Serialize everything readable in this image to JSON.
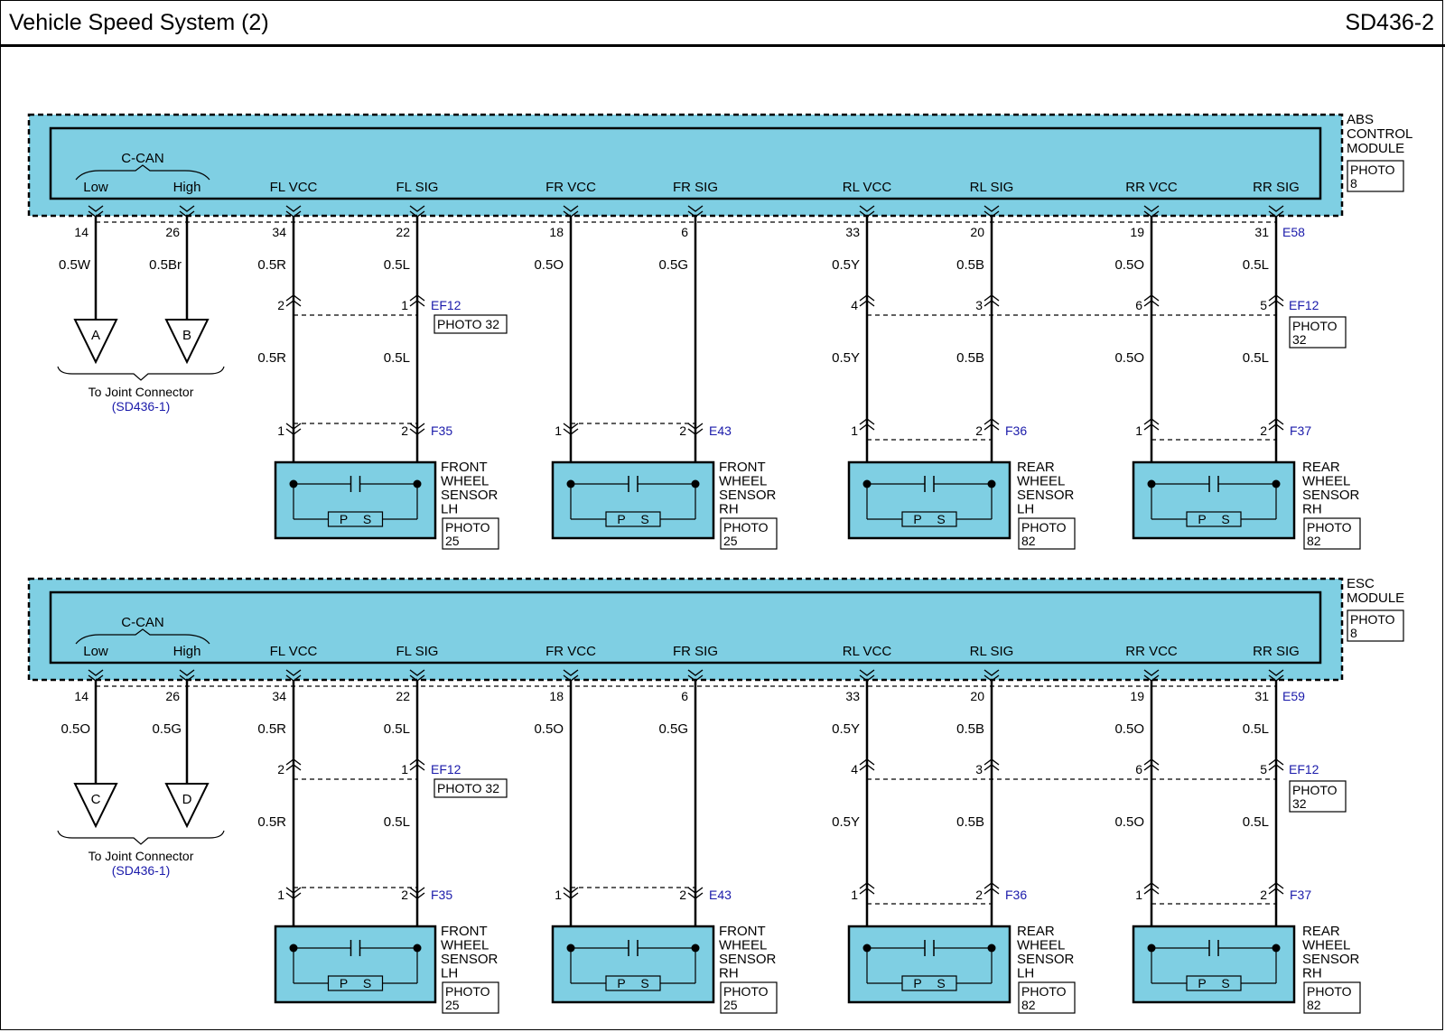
{
  "header": {
    "title": "Vehicle Speed System (2)",
    "code": "SD436-2"
  },
  "colors": {
    "module_fill": "#7fcfe3",
    "link_blue": "#1a1aaa",
    "wire": "#000000"
  },
  "modules": [
    {
      "id": "abs",
      "name_lines": [
        "ABS",
        "CONTROL",
        "MODULE"
      ],
      "photo_lines": [
        "PHOTO",
        "8"
      ],
      "bus_label": "C-CAN",
      "can_pins": [
        {
          "label": "Low",
          "pin": "14",
          "wire": "0.5W",
          "terminal": "A"
        },
        {
          "label": "High",
          "pin": "26",
          "wire": "0.5Br",
          "terminal": "B"
        }
      ],
      "joint_connector": "To Joint Connector",
      "joint_ref": "(SD436-1)",
      "main_connector": "E58",
      "channels": [
        {
          "label": "FL VCC",
          "pin": "34",
          "wire_top": "0.5R",
          "ef_pin": "2",
          "wire_bottom": "0.5R",
          "f_pin": "1"
        },
        {
          "label": "FL SIG",
          "pin": "22",
          "wire_top": "0.5L",
          "ef_pin": "1",
          "wire_bottom": "0.5L",
          "f_pin": "2"
        },
        {
          "label": "FR VCC",
          "pin": "18",
          "wire_top": "0.5O",
          "f_pin": "1"
        },
        {
          "label": "FR SIG",
          "pin": "6",
          "wire_top": "0.5G",
          "f_pin": "2"
        },
        {
          "label": "RL VCC",
          "pin": "33",
          "wire_top": "0.5Y",
          "ef_pin": "4",
          "wire_bottom": "0.5Y",
          "f_pin": "1"
        },
        {
          "label": "RL SIG",
          "pin": "20",
          "wire_top": "0.5B",
          "ef_pin": "3",
          "wire_bottom": "0.5B",
          "f_pin": "2"
        },
        {
          "label": "RR VCC",
          "pin": "19",
          "wire_top": "0.5O",
          "ef_pin": "6",
          "wire_bottom": "0.5O",
          "f_pin": "1"
        },
        {
          "label": "RR SIG",
          "pin": "31",
          "wire_top": "0.5L",
          "ef_pin": "5",
          "wire_bottom": "0.5L",
          "f_pin": "2"
        }
      ]
    },
    {
      "id": "esc",
      "name_lines": [
        "ESC",
        "MODULE"
      ],
      "photo_lines": [
        "PHOTO",
        "8"
      ],
      "bus_label": "C-CAN",
      "can_pins": [
        {
          "label": "Low",
          "pin": "14",
          "wire": "0.5O",
          "terminal": "C"
        },
        {
          "label": "High",
          "pin": "26",
          "wire": "0.5G",
          "terminal": "D"
        }
      ],
      "joint_connector": "To Joint Connector",
      "joint_ref": "(SD436-1)",
      "main_connector": "E59",
      "channels": [
        {
          "label": "FL VCC",
          "pin": "34",
          "wire_top": "0.5R",
          "ef_pin": "2",
          "wire_bottom": "0.5R",
          "f_pin": "1"
        },
        {
          "label": "FL SIG",
          "pin": "22",
          "wire_top": "0.5L",
          "ef_pin": "1",
          "wire_bottom": "0.5L",
          "f_pin": "2"
        },
        {
          "label": "FR VCC",
          "pin": "18",
          "wire_top": "0.5O",
          "f_pin": "1"
        },
        {
          "label": "FR SIG",
          "pin": "6",
          "wire_top": "0.5G",
          "f_pin": "2"
        },
        {
          "label": "RL VCC",
          "pin": "33",
          "wire_top": "0.5Y",
          "ef_pin": "4",
          "wire_bottom": "0.5Y",
          "f_pin": "1"
        },
        {
          "label": "RL SIG",
          "pin": "20",
          "wire_top": "0.5B",
          "ef_pin": "3",
          "wire_bottom": "0.5B",
          "f_pin": "2"
        },
        {
          "label": "RR VCC",
          "pin": "19",
          "wire_top": "0.5O",
          "ef_pin": "6",
          "wire_bottom": "0.5O",
          "f_pin": "1"
        },
        {
          "label": "RR SIG",
          "pin": "31",
          "wire_top": "0.5L",
          "ef_pin": "5",
          "wire_bottom": "0.5L",
          "f_pin": "2"
        }
      ]
    }
  ],
  "ef_connectors": [
    {
      "name": "EF12",
      "photo": "PHOTO 32"
    },
    {
      "name": "EF12",
      "photo_lines": [
        "PHOTO",
        "32"
      ]
    }
  ],
  "sensors": [
    {
      "connector": "F35",
      "name_lines": [
        "FRONT",
        "WHEEL",
        "SENSOR",
        "LH"
      ],
      "photo_lines": [
        "PHOTO",
        "25"
      ]
    },
    {
      "connector": "E43",
      "name_lines": [
        "FRONT",
        "WHEEL",
        "SENSOR",
        "RH"
      ],
      "photo_lines": [
        "PHOTO",
        "25"
      ]
    },
    {
      "connector": "F36",
      "name_lines": [
        "REAR",
        "WHEEL",
        "SENSOR",
        "LH"
      ],
      "photo_lines": [
        "PHOTO",
        "82"
      ]
    },
    {
      "connector": "F37",
      "name_lines": [
        "REAR",
        "WHEEL",
        "SENSOR",
        "RH"
      ],
      "photo_lines": [
        "PHOTO",
        "82"
      ]
    }
  ],
  "sensor_switch": {
    "p": "P",
    "s": "S"
  }
}
